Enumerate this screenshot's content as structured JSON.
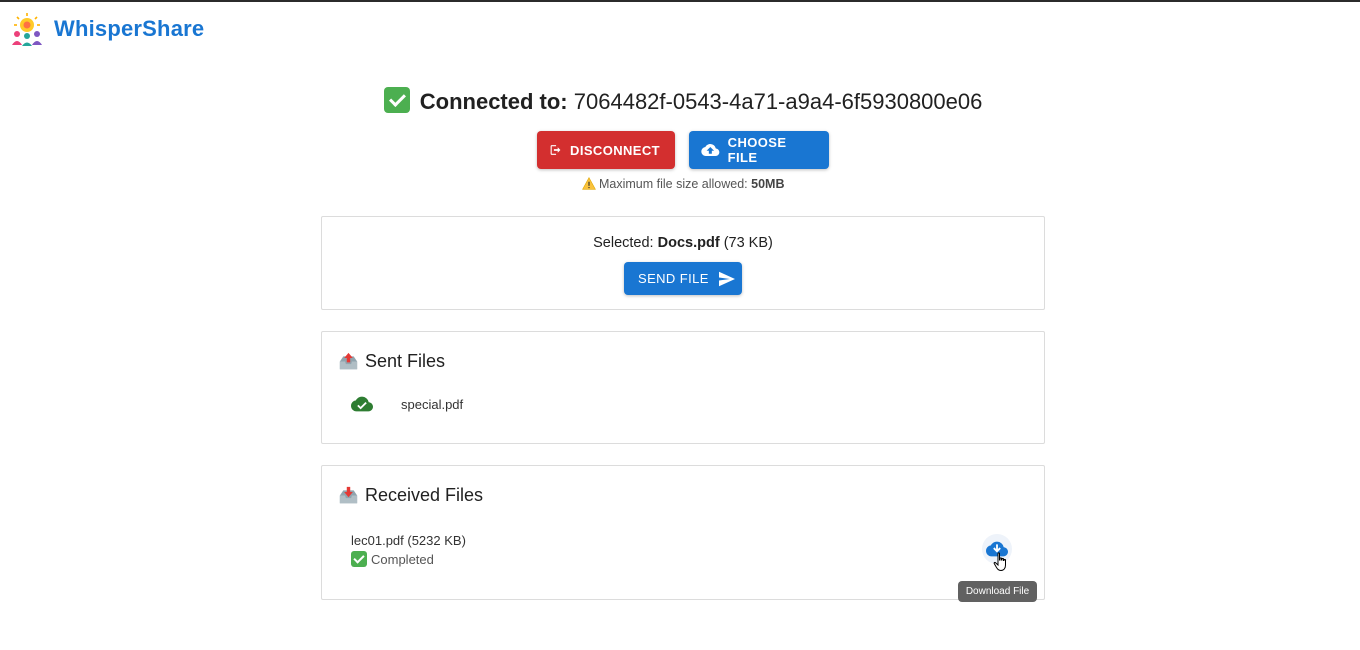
{
  "app": {
    "name": "WhisperShare"
  },
  "connection": {
    "label": "Connected to:",
    "peer_id": "7064482f-0543-4a71-a9a4-6f5930800e06"
  },
  "actions": {
    "disconnect_label": "DISCONNECT",
    "choose_file_label": "CHOOSE FILE"
  },
  "limits": {
    "warning_text": "Maximum file size allowed:",
    "max_size": "50MB"
  },
  "selection": {
    "prefix": "Selected:",
    "file_name": "Docs.pdf",
    "file_size": "(73 KB)",
    "send_label": "SEND FILE"
  },
  "sent": {
    "title": "Sent Files",
    "items": [
      {
        "name": "special.pdf",
        "status": "uploaded"
      }
    ]
  },
  "received": {
    "title": "Received Files",
    "items": [
      {
        "name": "lec01.pdf (5232 KB)",
        "status": "Completed",
        "action_tooltip": "Download File"
      }
    ]
  },
  "colors": {
    "primary": "#1976d2",
    "danger": "#d32f2f",
    "success": "#2e7d32"
  },
  "icons": {
    "logo": "lightbulb-people-logo",
    "connected": "check-box-icon",
    "disconnect": "logout-icon",
    "choose_file": "cloud-upload-icon",
    "warning": "warning-icon",
    "send": "send-icon",
    "sent_section": "outbox-tray-icon",
    "sent_item": "cloud-done-icon",
    "received_section": "inbox-tray-icon",
    "received_status": "check-box-icon",
    "download": "cloud-download-icon"
  }
}
